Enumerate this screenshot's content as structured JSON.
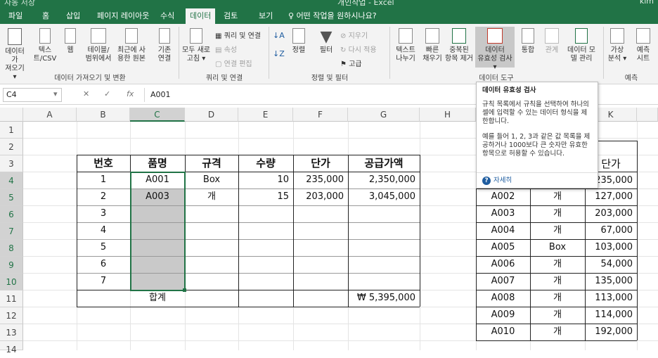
{
  "titlebar": {
    "autosave": "자동 저장",
    "title": "개인작업 - Excel",
    "user": "kim"
  },
  "tabs": [
    {
      "label": "파일"
    },
    {
      "label": "홈"
    },
    {
      "label": "삽입"
    },
    {
      "label": "페이지 레이아웃"
    },
    {
      "label": "수식"
    },
    {
      "label": "데이터"
    },
    {
      "label": "검토"
    },
    {
      "label": "보기"
    }
  ],
  "tell_me": "어떤 작업을 원하시나요?",
  "ribbon": {
    "get_data": {
      "line1": "데이터 가",
      "line2": "져오기 ▾"
    },
    "text_csv": {
      "line1": "텍스",
      "line2": "트/CSV"
    },
    "web": {
      "line1": "웹",
      "line2": ""
    },
    "table_range": {
      "line1": "테이블/",
      "line2": "범위에서"
    },
    "recent_sources": {
      "line1": "최근에 사",
      "line2": "용한 원본"
    },
    "existing_conn": {
      "line1": "기존",
      "line2": "연결"
    },
    "group_get": "데이터 가져오기 및 변환",
    "refresh_all": {
      "line1": "모두 새로",
      "line2": "고침 ▾"
    },
    "queries_conn": "쿼리 및 연결",
    "properties": "속성",
    "edit_links": "연결 편집",
    "group_queries": "쿼리 및 연결",
    "sort_label": "정렬",
    "filter_label": "필터",
    "clear_label": "지우기",
    "reapply_label": "다시 적용",
    "advanced_label": "고급",
    "group_sort": "정렬 및 필터",
    "text_to_columns": {
      "line1": "텍스트",
      "line2": "나누기"
    },
    "flash_fill": {
      "line1": "빠른",
      "line2": "채우기"
    },
    "remove_dup": {
      "line1": "중복된",
      "line2": "항목 제거"
    },
    "data_validation": {
      "line1": "데이터",
      "line2": "유효성 검사 ▾"
    },
    "consolidate": "통합",
    "relationships": "관계",
    "data_model": {
      "line1": "데이터 모",
      "line2": "델 관리"
    },
    "group_tools": "데이터 도구",
    "what_if": {
      "line1": "가상",
      "line2": "분석 ▾"
    },
    "forecast_sheet": {
      "line1": "예측",
      "line2": "시트"
    },
    "group_forecast": "예측"
  },
  "formula_bar": {
    "namebox": "C4",
    "fx": "fx",
    "value": "A001"
  },
  "columns": [
    "A",
    "B",
    "C",
    "D",
    "E",
    "F",
    "G",
    "H",
    "K"
  ],
  "rows": [
    "1",
    "2",
    "3",
    "4",
    "5",
    "6",
    "7",
    "8",
    "9",
    "10",
    "11",
    "12",
    "13",
    "14"
  ],
  "main_table": {
    "headers": [
      "번호",
      "품명",
      "규격",
      "수량",
      "단가",
      "공급가액"
    ],
    "rows": [
      [
        "1",
        "A001",
        "Box",
        "10",
        "235,000",
        "2,350,000"
      ],
      [
        "2",
        "A003",
        "개",
        "15",
        "203,000",
        "3,045,000"
      ],
      [
        "3",
        "",
        "",
        "",
        "",
        ""
      ],
      [
        "4",
        "",
        "",
        "",
        "",
        ""
      ],
      [
        "5",
        "",
        "",
        "",
        "",
        ""
      ],
      [
        "6",
        "",
        "",
        "",
        "",
        ""
      ],
      [
        "7",
        "",
        "",
        "",
        "",
        ""
      ]
    ],
    "total_label": "합계",
    "total_value": "₩ 5,395,000"
  },
  "lookup_table": {
    "header_price": "단가",
    "first_price": "235,000",
    "rows": [
      [
        "A002",
        "개",
        "127,000"
      ],
      [
        "A003",
        "개",
        "203,000"
      ],
      [
        "A004",
        "개",
        "67,000"
      ],
      [
        "A005",
        "Box",
        "103,000"
      ],
      [
        "A006",
        "개",
        "54,000"
      ],
      [
        "A007",
        "개",
        "135,000"
      ],
      [
        "A008",
        "개",
        "113,000"
      ],
      [
        "A009",
        "개",
        "114,000"
      ],
      [
        "A010",
        "개",
        "192,000"
      ]
    ]
  },
  "tooltip": {
    "title": "데이터 유효성 검사",
    "p1": "규칙 목록에서 규칙을 선택하여 하나의 셀에 입력할 수 있는 데이터 형식을 제한합니다.",
    "p2": "예를 들어 1, 2, 3과 같은 값 목록을 제공하거나 1000보다 큰 숫자만 유효한 항목으로 허용할 수 있습니다.",
    "more": "자세히"
  },
  "colors": {
    "excel_green": "#217346",
    "selection_gray": "#c9c9c9",
    "link_blue": "#1f5da0"
  }
}
